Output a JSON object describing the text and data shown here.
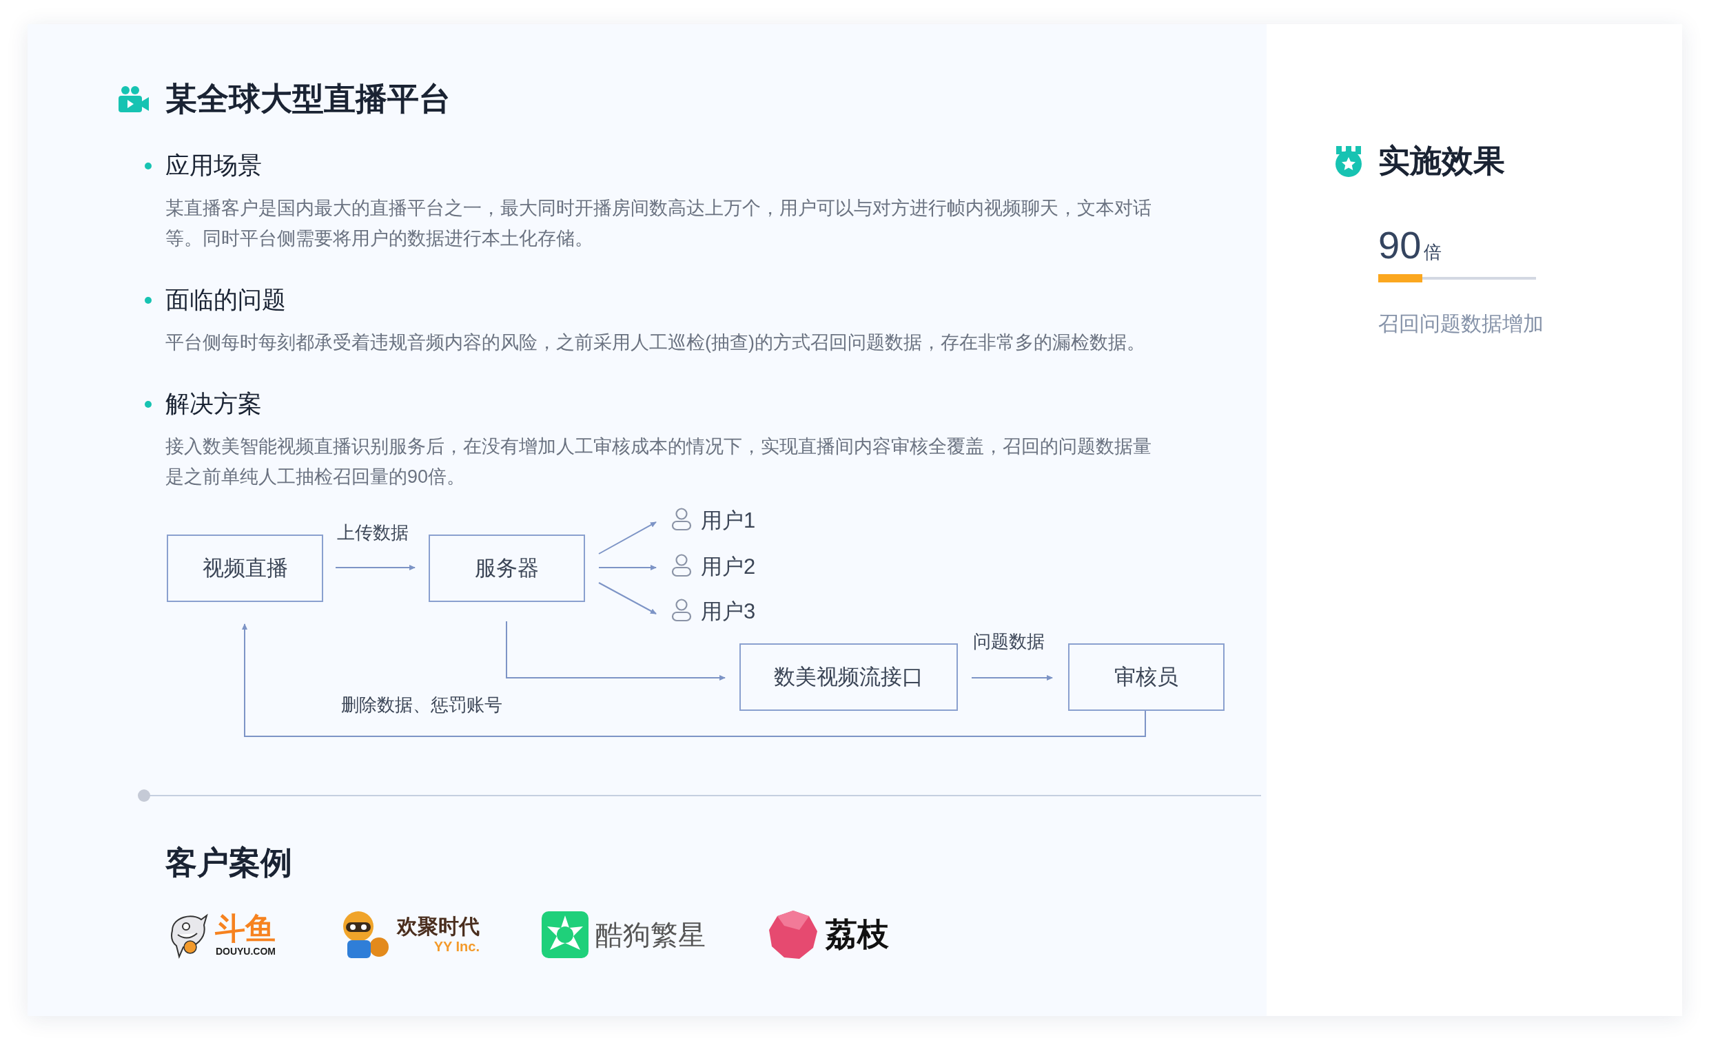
{
  "case": {
    "title": "某全球大型直播平台",
    "sections": [
      {
        "heading": "应用场景",
        "text": "某直播客户是国内最大的直播平台之一，最大同时开播房间数高达上万个，用户可以与对方进行帧内视频聊天，文本对话等。同时平台侧需要将用户的数据进行本土化存储。"
      },
      {
        "heading": "面临的问题",
        "text": "平台侧每时每刻都承受着违规音频内容的风险，之前采用人工巡检(抽查)的方式召回问题数据，存在非常多的漏检数据。"
      },
      {
        "heading": "解决方案",
        "text": "接入数美智能视频直播识别服务后，在没有增加人工审核成本的情况下，实现直播间内容审核全覆盖，召回的问题数据量是之前单纯人工抽检召回量的90倍。"
      }
    ]
  },
  "diagram": {
    "nodes": [
      "视频直播",
      "服务器",
      "数美视频流接口",
      "审核员"
    ],
    "users": [
      "用户1",
      "用户2",
      "用户3"
    ],
    "edge_labels": [
      "上传数据",
      "问题数据",
      "删除数据、惩罚账号"
    ]
  },
  "customers": {
    "title": "客户案例",
    "logos": [
      {
        "kind": "douyu",
        "name": "斗鱼",
        "subtitle": "DOUYU.COM"
      },
      {
        "kind": "yy",
        "name": "欢聚时代",
        "subtitle": "YY Inc."
      },
      {
        "kind": "kugou",
        "name": "酷狗繁星"
      },
      {
        "kind": "lizhi",
        "name": "荔枝"
      }
    ]
  },
  "results": {
    "title": "实施效果",
    "value": "90",
    "unit": "倍",
    "level": 0.28,
    "label": "召回问题数据增加"
  }
}
